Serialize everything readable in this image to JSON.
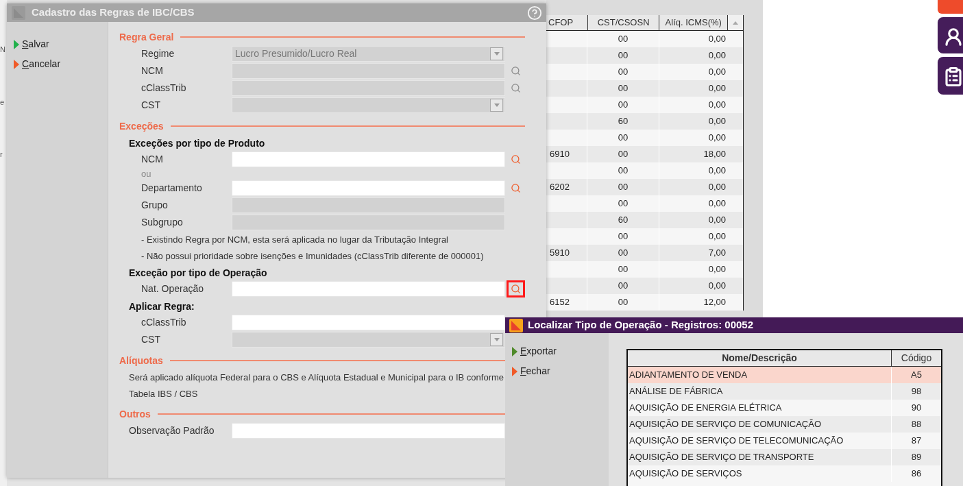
{
  "background": {
    "fragments": [
      "N",
      "e",
      "r"
    ],
    "grid": {
      "columns": [
        "CFOP",
        "CST/CSOSN",
        "Alíq. ICMS(%)"
      ],
      "rows": [
        [
          "",
          "00",
          "0,00"
        ],
        [
          "",
          "00",
          "0,00"
        ],
        [
          "",
          "00",
          "0,00"
        ],
        [
          "",
          "00",
          "0,00"
        ],
        [
          "",
          "00",
          "0,00"
        ],
        [
          "",
          "60",
          "0,00"
        ],
        [
          "",
          "00",
          "0,00"
        ],
        [
          "6910",
          "00",
          "18,00"
        ],
        [
          "",
          "00",
          "0,00"
        ],
        [
          "6202",
          "00",
          "0,00"
        ],
        [
          "",
          "00",
          "0,00"
        ],
        [
          "",
          "60",
          "0,00"
        ],
        [
          "",
          "00",
          "0,00"
        ],
        [
          "5910",
          "00",
          "7,00"
        ],
        [
          "",
          "00",
          "0,00"
        ],
        [
          "",
          "00",
          "0,00"
        ],
        [
          "6152",
          "00",
          "12,00"
        ]
      ]
    }
  },
  "dialog": {
    "title": "Cadastro das Regras de IBC/CBS",
    "actions": [
      {
        "label": "Salvar",
        "kind": "save"
      },
      {
        "label": "Cancelar",
        "kind": "cancel"
      }
    ],
    "sections": [
      {
        "title": "Regra Geral",
        "items": [
          {
            "kind": "select",
            "label": "Regime",
            "disabled": true,
            "value": "Lucro Presumido/Lucro Real"
          },
          {
            "kind": "lookup",
            "label": "NCM",
            "disabled": true,
            "focused": false
          },
          {
            "kind": "lookup",
            "label": "cClassTrib",
            "disabled": true,
            "focused": false
          },
          {
            "kind": "select",
            "label": "CST",
            "disabled": true
          }
        ]
      },
      {
        "title": "Exceções",
        "items": [
          {
            "kind": "subheading",
            "text": "Exceções por tipo de Produto"
          },
          {
            "kind": "lookup",
            "label": "NCM",
            "disabled": false,
            "focused": false
          },
          {
            "kind": "hint",
            "text": "ou"
          },
          {
            "kind": "lookup",
            "label": "Departamento",
            "disabled": false,
            "focused": false
          },
          {
            "kind": "text",
            "label": "Grupo",
            "disabled": true
          },
          {
            "kind": "text",
            "label": "Subgrupo",
            "disabled": true
          },
          {
            "kind": "note",
            "text": "- Existindo Regra por NCM, esta será aplicada no lugar da Tributação Integral"
          },
          {
            "kind": "note",
            "text": "- Não possui prioridade sobre isenções e Imunidades (cClassTrib diferente de 000001)"
          },
          {
            "kind": "subheading",
            "text": "Exceção por tipo de Operação"
          },
          {
            "kind": "lookup",
            "label": "Nat. Operação",
            "disabled": false,
            "focused": true
          },
          {
            "kind": "subheading",
            "text": "Aplicar Regra:"
          },
          {
            "kind": "text",
            "label": "cClassTrib",
            "disabled": false
          },
          {
            "kind": "select",
            "label": "CST",
            "disabled": true
          }
        ]
      },
      {
        "title": "Alíquotas",
        "items": [
          {
            "kind": "paragraph",
            "text": "Será aplicado alíquota Federal para o CBS e Alíquota Estadual e Municipal para o IB conforme Tabela IBS / CBS"
          }
        ]
      },
      {
        "title": "Outros",
        "items": [
          {
            "kind": "wide_text",
            "label": "Observação Padrão",
            "disabled": false
          }
        ]
      }
    ]
  },
  "lookup": {
    "title": "Localizar Tipo de Operação - Registros: 00052",
    "actions": [
      {
        "label": "Exportar",
        "kind": "export"
      },
      {
        "label": "Fechar",
        "kind": "close"
      }
    ],
    "columns": [
      "Nome/Descrição",
      "Código"
    ],
    "rows": [
      {
        "name": "ADIANTAMENTO DE VENDA",
        "code": "A5",
        "selected": true
      },
      {
        "name": "ANÁLISE DE FÁBRICA",
        "code": "98",
        "selected": false
      },
      {
        "name": "AQUISIÇÃO DE ENERGIA ELÉTRICA",
        "code": "90",
        "selected": false
      },
      {
        "name": "AQUISIÇÃO DE SERVIÇO DE COMUNICAÇÃO",
        "code": "88",
        "selected": false
      },
      {
        "name": "AQUISIÇÃO DE SERVIÇO DE TELECOMUNICAÇÃO",
        "code": "87",
        "selected": false
      },
      {
        "name": "AQUISIÇÃO DE SERVIÇO DE TRANSPORTE",
        "code": "89",
        "selected": false
      },
      {
        "name": "AQUISIÇÃO DE SERVIÇOS",
        "code": "86",
        "selected": false
      }
    ]
  }
}
